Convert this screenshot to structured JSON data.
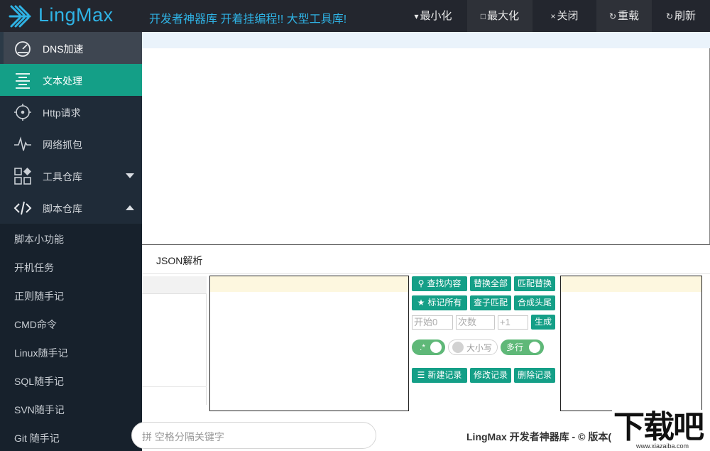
{
  "app": {
    "logo_text": "LingMax",
    "tagline": "开发者神器库 开着挂编程!! 大型工具库!"
  },
  "window_buttons": [
    {
      "glyph": "▾",
      "label": "最小化"
    },
    {
      "glyph": "□",
      "label": "最大化"
    },
    {
      "glyph": "×",
      "label": "关闭"
    },
    {
      "glyph": "↻",
      "label": "重载"
    },
    {
      "glyph": "↻",
      "label": "刷新"
    }
  ],
  "sidebar": {
    "items": [
      {
        "label": "DNS加速",
        "icon": "speedometer-icon"
      },
      {
        "label": "文本处理",
        "icon": "align-center-icon",
        "active": true
      },
      {
        "label": "Http请求",
        "icon": "crosshair-icon"
      },
      {
        "label": "网络抓包",
        "icon": "pulse-icon"
      },
      {
        "label": "工具仓库",
        "icon": "apps-icon",
        "caret": "down"
      },
      {
        "label": "脚本仓库",
        "icon": "code-icon",
        "caret": "up"
      }
    ],
    "sub_items": [
      "脚本小功能",
      "开机任务",
      "正则随手记",
      "CMD命令",
      "Linux随手记",
      "SQL随手记",
      "SVN随手记",
      "Git 随手记"
    ]
  },
  "tabs": {
    "json_label": "JSON解析"
  },
  "actions": {
    "find": "查找内容",
    "replace_all": "替换全部",
    "match_replace": "匹配替换",
    "mark_all": "标记所有",
    "sub_match": "查子匹配",
    "join_head_tail": "合成头尾",
    "start_placeholder": "开始0",
    "count_placeholder": "次数",
    "step_placeholder": "+1",
    "generate": "生成",
    "regex_toggle": ".*",
    "case_toggle": "大小写",
    "multiline_toggle": "多行",
    "new_record": "新建记录",
    "edit_record": "修改记录",
    "delete_record": "删除记录"
  },
  "bottom": {
    "search_placeholder": "拼 空格分隔关键字",
    "footer": "LingMax 开发者神器库 - © 版本("
  },
  "watermark": {
    "big": "下载吧",
    "small": "www.xiazaiba.com"
  },
  "colors": {
    "topbar": "#23262e",
    "sidebar": "#1f2b38",
    "accent": "#149f87",
    "logo": "#2fb3e5",
    "toggle_on": "#5fb878"
  }
}
